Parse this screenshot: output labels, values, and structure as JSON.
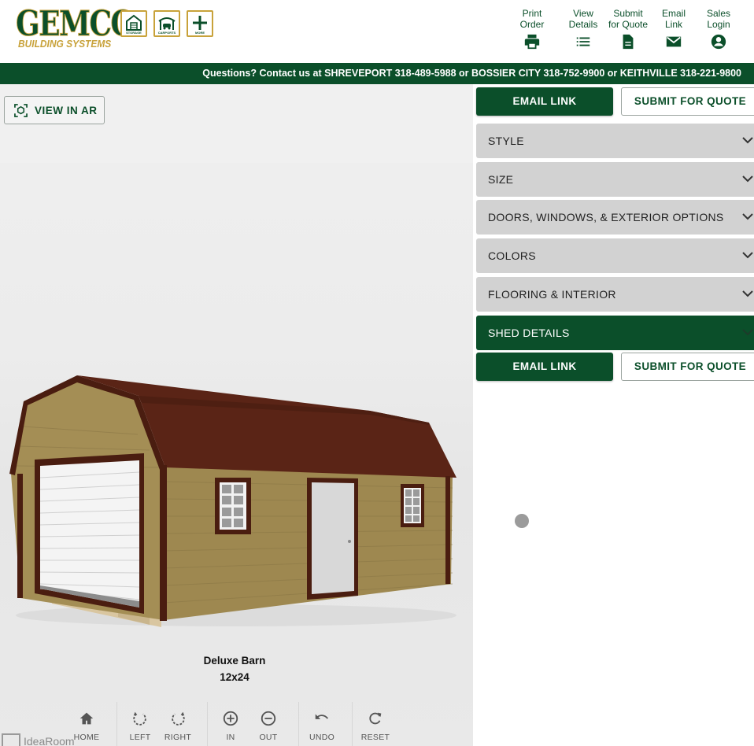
{
  "header": {
    "logo_text": "GEMCO",
    "logo_subtext": "BUILDING SYSTEMS",
    "categories": [
      {
        "label": "STORAGE",
        "icon": "storage-building-icon"
      },
      {
        "label": "CARPORTS",
        "icon": "carport-icon"
      },
      {
        "label": "MORE",
        "icon": "plus-icon"
      }
    ],
    "utility_links": [
      {
        "label": "Print\nOrder",
        "icon": "printer-icon"
      },
      {
        "label": "View\nDetails",
        "icon": "list-icon"
      },
      {
        "label": "Submit\nfor Quote",
        "icon": "document-icon"
      },
      {
        "label": "Email\nLink",
        "icon": "envelope-icon"
      },
      {
        "label": "Sales\nLogin",
        "icon": "account-circle-icon"
      }
    ]
  },
  "contact_bar": {
    "text": "Questions? Contact us at SHREVEPORT 318-489-5988 or BOSSIER CITY 318-752-9900 or KEITHVILLE 318-221-9800"
  },
  "viewer": {
    "ar_button_label": "VIEW IN AR",
    "model_name": "Deluxe Barn",
    "model_size": "12x24",
    "watermark": "IdeaRoom",
    "toolbar": [
      {
        "label": "HOME",
        "icon": "home-icon"
      },
      {
        "label": "LEFT",
        "icon": "rotate-left-icon"
      },
      {
        "label": "RIGHT",
        "icon": "rotate-right-icon"
      },
      {
        "label": "IN",
        "icon": "zoom-in-icon"
      },
      {
        "label": "OUT",
        "icon": "zoom-out-icon"
      },
      {
        "label": "UNDO",
        "icon": "undo-icon"
      },
      {
        "label": "RESET",
        "icon": "reset-icon"
      }
    ]
  },
  "panel": {
    "email_link_label": "EMAIL LINK",
    "submit_quote_label": "SUBMIT FOR QUOTE",
    "sections": [
      {
        "label": "STYLE",
        "active": false
      },
      {
        "label": "SIZE",
        "active": false
      },
      {
        "label": "DOORS, WINDOWS, & EXTERIOR OPTIONS",
        "active": false
      },
      {
        "label": "COLORS",
        "active": false
      },
      {
        "label": "FLOORING & INTERIOR",
        "active": false
      },
      {
        "label": "SHED DETAILS",
        "active": true
      }
    ]
  },
  "colors": {
    "brand_green": "#0b4f2a",
    "brand_gold": "#c8a23a",
    "accordion_gray": "#d2d2d2",
    "roof_brown": "#5a2416",
    "siding_tan": "#a48e55"
  }
}
